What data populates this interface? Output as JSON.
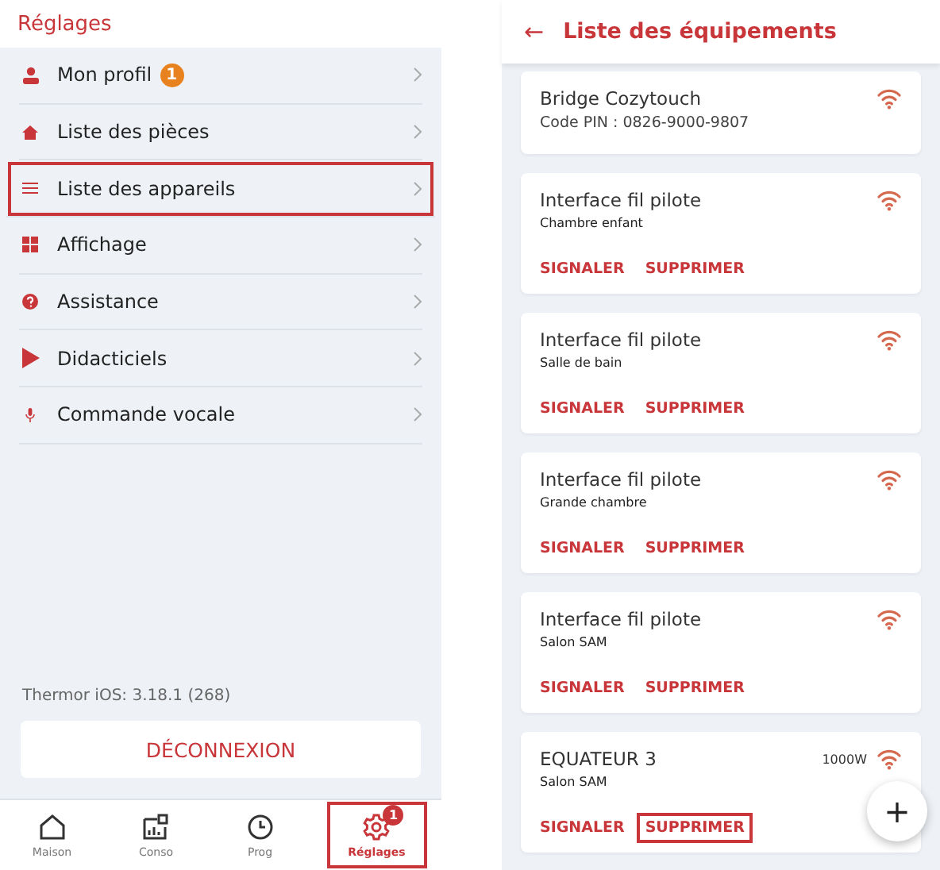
{
  "settings": {
    "title": "Réglages",
    "menu": [
      {
        "kind": "person",
        "label": "Mon profil",
        "badge": "1",
        "highlighted": false
      },
      {
        "kind": "house",
        "label": "Liste des pièces",
        "highlighted": false
      },
      {
        "kind": "lines",
        "label": "Liste des appareils",
        "highlighted": true
      },
      {
        "kind": "grid",
        "label": "Affichage",
        "highlighted": false
      },
      {
        "kind": "question",
        "label": "Assistance",
        "highlighted": false
      },
      {
        "kind": "play",
        "label": "Didacticiels",
        "highlighted": false
      },
      {
        "kind": "mic",
        "label": "Commande vocale",
        "highlighted": false
      }
    ],
    "version": "Thermor iOS: 3.18.1 (268)",
    "logout": "DÉCONNEXION",
    "tabs": [
      {
        "kind": "home",
        "label": "Maison",
        "selected": false,
        "highlighted": false
      },
      {
        "kind": "chart",
        "label": "Conso",
        "selected": false,
        "highlighted": false
      },
      {
        "kind": "clock",
        "label": "Prog",
        "selected": false,
        "highlighted": false
      },
      {
        "kind": "gear",
        "label": "Réglages",
        "selected": true,
        "highlighted": true,
        "badge": "1"
      }
    ]
  },
  "equipment": {
    "back": "←",
    "title": "Liste des équipements",
    "cards": [
      {
        "title": "Bridge Cozytouch",
        "subtitle": "Code PIN : 0826-9000-9807",
        "kind": "bridge"
      },
      {
        "title": "Interface fil pilote",
        "subtitle": "Chambre enfant",
        "kind": "device",
        "actions": [
          {
            "label": "SIGNALER",
            "highlighted": false
          },
          {
            "label": "SUPPRIMER",
            "highlighted": false
          }
        ]
      },
      {
        "title": "Interface fil pilote",
        "subtitle": "Salle de bain",
        "kind": "device",
        "actions": [
          {
            "label": "SIGNALER",
            "highlighted": false
          },
          {
            "label": "SUPPRIMER",
            "highlighted": false
          }
        ]
      },
      {
        "title": "Interface fil pilote",
        "subtitle": "Grande chambre",
        "kind": "device",
        "actions": [
          {
            "label": "SIGNALER",
            "highlighted": false
          },
          {
            "label": "SUPPRIMER",
            "highlighted": false
          }
        ]
      },
      {
        "title": "Interface fil pilote",
        "subtitle": "Salon SAM",
        "kind": "device",
        "actions": [
          {
            "label": "SIGNALER",
            "highlighted": false
          },
          {
            "label": "SUPPRIMER",
            "highlighted": false
          }
        ]
      },
      {
        "title": "EQUATEUR 3",
        "subtitle": "Salon SAM",
        "power": "1000W",
        "kind": "device",
        "actions": [
          {
            "label": "SIGNALER",
            "highlighted": false
          },
          {
            "label": "SUPPRIMER",
            "highlighted": true
          }
        ]
      }
    ],
    "fab": "+"
  }
}
